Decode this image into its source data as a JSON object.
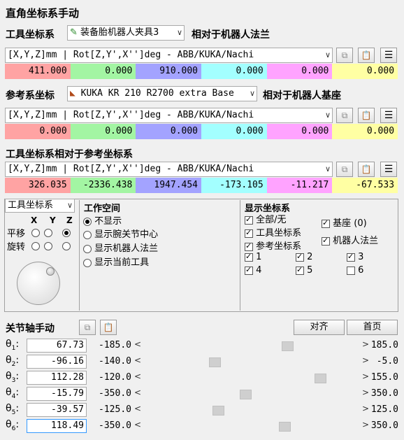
{
  "title": "直角坐标系手动",
  "tool": {
    "label": "工具坐标系",
    "selected": "装备胎机器人夹具3",
    "relative": "相对于机器人法兰",
    "format": "[X,Y,Z]mm | Rot[Z,Y',X'']deg - ABB/KUKA/Nachi",
    "values": [
      "411.000",
      "0.000",
      "910.000",
      "0.000",
      "0.000",
      "0.000"
    ]
  },
  "reference": {
    "label": "参考系坐标",
    "selected": "KUKA KR 210 R2700 extra Base",
    "relative": "相对于机器人基座",
    "format": "[X,Y,Z]mm | Rot[Z,Y',X'']deg - ABB/KUKA/Nachi",
    "values": [
      "0.000",
      "0.000",
      "0.000",
      "0.000",
      "0.000",
      "0.000"
    ]
  },
  "tool_in_ref": {
    "label": "工具坐标系相对于参考坐标系",
    "format": "[X,Y,Z]mm | Rot[Z,Y',X'']deg - ABB/KUKA/Nachi",
    "values": [
      "326.035",
      "-2336.438",
      "1947.454",
      "-173.105",
      "-11.217",
      "-67.533"
    ]
  },
  "jog": {
    "frame_select": "工具坐标系",
    "axes": [
      "X",
      "Y",
      "Z"
    ],
    "translate_label": "平移",
    "rotate_label": "旋转"
  },
  "workspace": {
    "title": "工作空间",
    "options": [
      "不显示",
      "显示腕关节中心",
      "显示机器人法兰",
      "显示当前工具"
    ],
    "selected_index": 0
  },
  "display_frames": {
    "title": "显示坐标系",
    "items": [
      {
        "label": "全部/无",
        "checked": true
      },
      {
        "label": "工具坐标系",
        "checked": true
      },
      {
        "label": "参考坐标系",
        "checked": true
      },
      {
        "label": "基座 (0)",
        "checked": true
      },
      {
        "label": "机器人法兰",
        "checked": true
      }
    ],
    "numbers": [
      {
        "label": "1",
        "checked": true
      },
      {
        "label": "2",
        "checked": true
      },
      {
        "label": "3",
        "checked": true
      },
      {
        "label": "4",
        "checked": true
      },
      {
        "label": "5",
        "checked": true
      },
      {
        "label": "6",
        "checked": false
      }
    ]
  },
  "joints": {
    "title": "关节轴手动",
    "align_button": "对齐",
    "home_button": "首页",
    "items": [
      {
        "label": "θ",
        "sub": "1",
        "value": "67.73",
        "min": "-185.0",
        "max": "185.0",
        "fraction": 0.683
      },
      {
        "label": "θ",
        "sub": "2",
        "value": "-96.16",
        "min": "-140.0",
        "max": "-5.0",
        "fraction": 0.325
      },
      {
        "label": "θ",
        "sub": "3",
        "value": "112.28",
        "min": "-120.0",
        "max": "155.0",
        "fraction": 0.845
      },
      {
        "label": "θ",
        "sub": "4",
        "value": "-15.79",
        "min": "-350.0",
        "max": "350.0",
        "fraction": 0.477
      },
      {
        "label": "θ",
        "sub": "5",
        "value": "-39.57",
        "min": "-125.0",
        "max": "125.0",
        "fraction": 0.342
      },
      {
        "label": "θ",
        "sub": "6",
        "value": "118.49",
        "min": "-350.0",
        "max": "350.0",
        "fraction": 0.669
      }
    ]
  }
}
